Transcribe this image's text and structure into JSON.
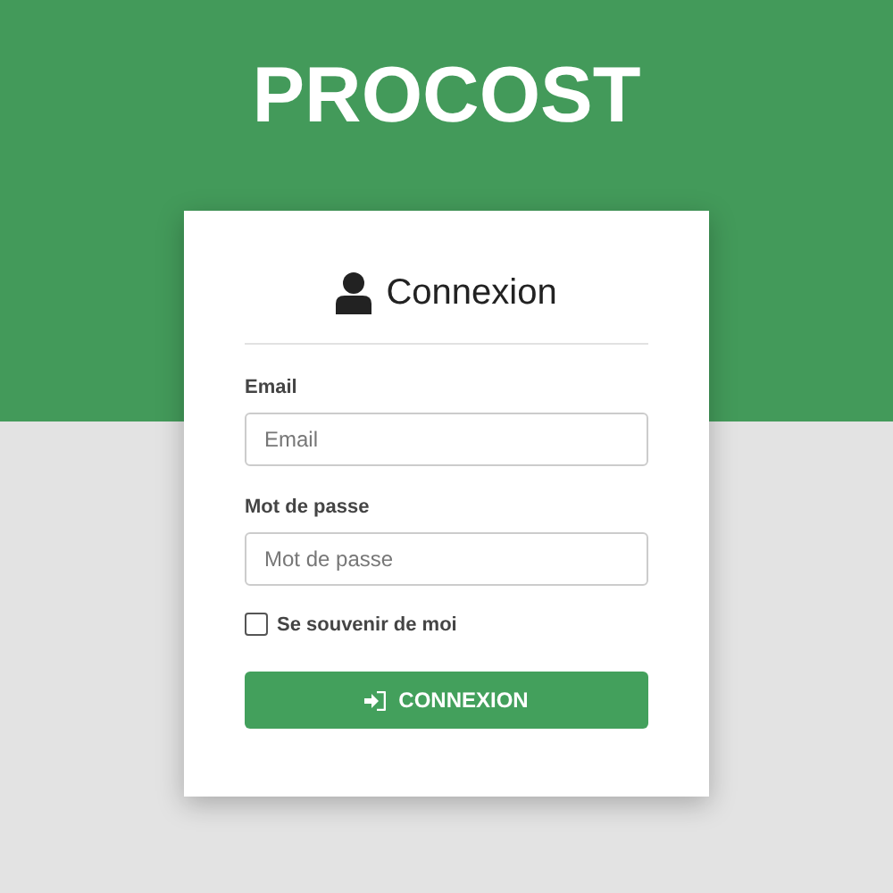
{
  "brand": "PROCOST",
  "card": {
    "title": "Connexion",
    "fields": [
      {
        "label": "Email",
        "placeholder": "Email"
      },
      {
        "label": "Mot de passe",
        "placeholder": "Mot de passe"
      }
    ],
    "remember": {
      "label": "Se souvenir de moi",
      "checked": false
    },
    "submit": "CONNEXION"
  }
}
